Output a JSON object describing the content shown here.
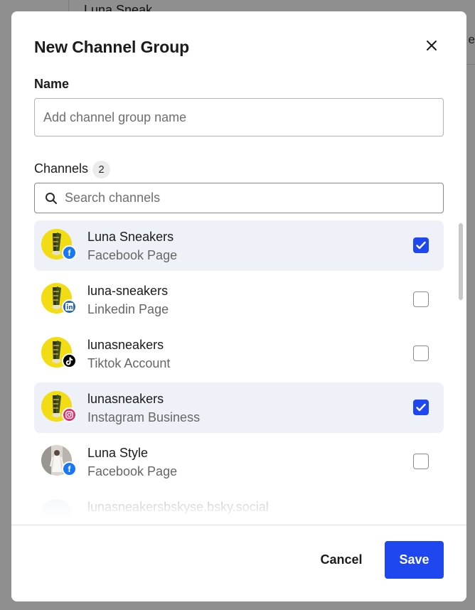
{
  "background": {
    "title_fragment": "Luna Sneak",
    "tab_fragment": "e"
  },
  "dialog": {
    "title": "New Channel Group",
    "name_label": "Name",
    "name_placeholder": "Add channel group name",
    "name_value": "",
    "channels_label": "Channels",
    "selected_count": "2",
    "search_placeholder": "Search channels",
    "search_value": "",
    "channels": [
      {
        "name": "Luna Sneakers",
        "type": "Facebook Page",
        "network": "facebook",
        "checked": true
      },
      {
        "name": "luna-sneakers",
        "type": "Linkedin Page",
        "network": "linkedin",
        "checked": false
      },
      {
        "name": "lunasneakers",
        "type": "Tiktok Account",
        "network": "tiktok",
        "checked": false
      },
      {
        "name": "lunasneakers",
        "type": "Instagram Business",
        "network": "instagram",
        "checked": true
      },
      {
        "name": "Luna Style",
        "type": "Facebook Page",
        "network": "facebook",
        "checked": false
      },
      {
        "name": "lunasneakersbskyse.bsky.social",
        "type": "",
        "network": "bluesky",
        "checked": false
      }
    ],
    "cancel_label": "Cancel",
    "save_label": "Save"
  },
  "colors": {
    "primary": "#1f47f0",
    "selected_row": "#eef1f7",
    "facebook": "#1877f2",
    "linkedin": "#2867b2",
    "tiktok": "#000000",
    "instagram": "#e1306c"
  },
  "icons": {
    "close": "close-icon",
    "search": "search-icon",
    "check": "check-icon"
  }
}
